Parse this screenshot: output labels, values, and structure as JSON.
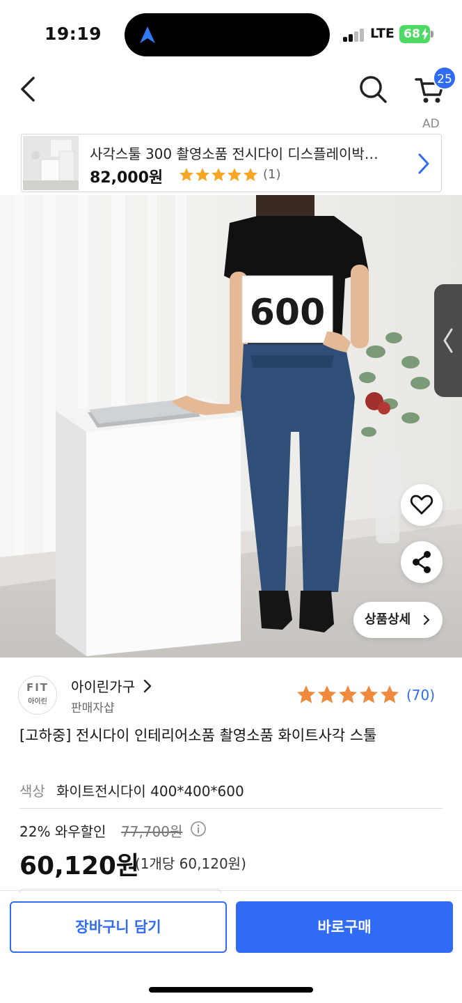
{
  "status_bar": {
    "time": "19:19",
    "network": "LTE",
    "battery": "68"
  },
  "header": {
    "cart_count": "25",
    "ad_label": "AD"
  },
  "ad": {
    "title": "사각스툴 300 촬영소품 전시다이 디스플레이박…",
    "price": "82,000원",
    "rating": 5,
    "review_count": "(1)"
  },
  "hero": {
    "sign_text": "600",
    "detail_button": "상품상세",
    "image_count": 6,
    "current_index": 0
  },
  "seller": {
    "logo_text": "FIT",
    "logo_subtext": "아이린",
    "name": "아이린가구",
    "tag": "판매자샵",
    "rating": 5,
    "review_count": "(70)"
  },
  "product": {
    "title": "[고하중] 전시다이 인테리어소품 촬영소품 화이트사각 스툴",
    "option_label": "색상",
    "option_value": "화이트전시다이 400*400*600",
    "discount_text": "22% 와우할인",
    "original_price": "77,700원",
    "price": "60,120원",
    "unit_price": "(1개당 60,120원)"
  },
  "actions": {
    "add_to_cart": "장바구니 담기",
    "buy_now": "바로구매"
  },
  "colors": {
    "accent": "#2f6bf3",
    "star": "#f5a623",
    "rating_star": "#f08a3c"
  }
}
